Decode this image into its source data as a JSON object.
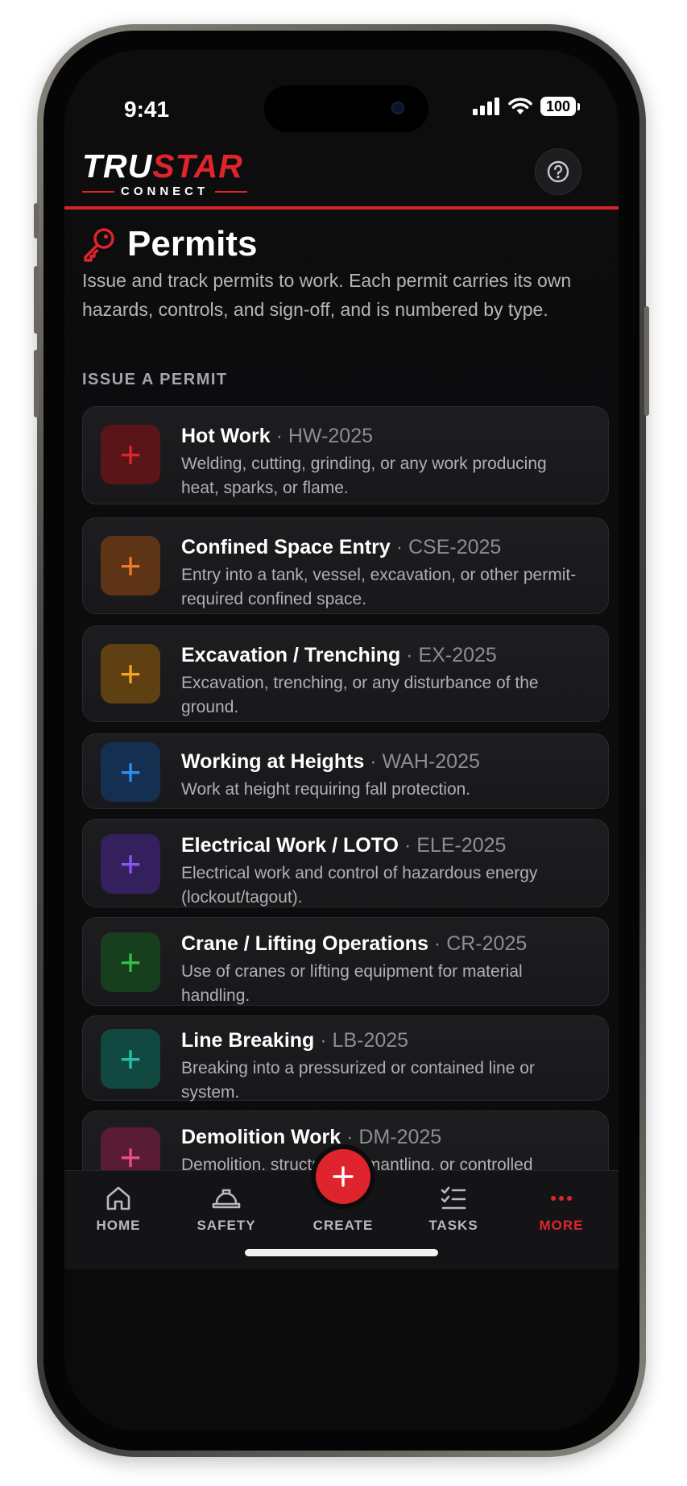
{
  "status_bar": {
    "time": "9:41",
    "battery": "100"
  },
  "header": {
    "logo_tru": "TRU",
    "logo_star": "STAR",
    "logo_sub": "CONNECT",
    "help_icon": "question-circle-icon"
  },
  "page": {
    "title": "Permits",
    "title_icon": "key-icon",
    "intro": "Issue and track permits to work. Each permit carries its own hazards, controls, and sign-off, and is numbered by type.",
    "section_label": "ISSUE A PERMIT"
  },
  "permits": [
    {
      "title": "Hot Work",
      "code": " · HW-2025",
      "desc": "Welding, cutting, grinding, or any work producing heat, sparks, or flame.",
      "color": "#e0242d",
      "bg": "#5a1518"
    },
    {
      "title": "Confined Space Entry",
      "code": " · CSE-2025",
      "desc": "Entry into a tank, vessel, excavation, or other permit-required confined space.",
      "color": "#f07a2a",
      "bg": "#5e3416"
    },
    {
      "title": "Excavation / Trenching",
      "code": " · EX-2025",
      "desc": "Excavation, trenching, or any disturbance of the ground.",
      "color": "#f5a523",
      "bg": "#5f4012"
    },
    {
      "title": "Working at Heights",
      "code": " · WAH-2025",
      "desc": "Work at height requiring fall protection.",
      "color": "#2f8ff0",
      "bg": "#142f4f"
    },
    {
      "title": "Electrical Work / LOTO",
      "code": " · ELE-2025",
      "desc": "Electrical work and control of hazardous energy (lockout/tagout).",
      "color": "#8a55f2",
      "bg": "#33205c"
    },
    {
      "title": "Crane / Lifting Operations",
      "code": " · CR-2025",
      "desc": "Use of cranes or lifting equipment for material handling.",
      "color": "#34c046",
      "bg": "#183f1d"
    },
    {
      "title": "Line Breaking",
      "code": " · LB-2025",
      "desc": "Breaking into a pressurized or contained line or system.",
      "color": "#23c2a8",
      "bg": "#114840"
    },
    {
      "title": "Demolition Work",
      "code": " · DM-2025",
      "desc": "Demolition, structural dismantling, or controlled deconstruction.",
      "color": "#ea4f86",
      "bg": "#5a1c34"
    }
  ],
  "tabs": {
    "home": "HOME",
    "safety": "SAFETY",
    "create": "CREATE",
    "tasks": "TASKS",
    "more": "MORE"
  },
  "colors": {
    "accent": "#e0242d",
    "background": "#0c0c0d",
    "card": "#1b1b1e"
  }
}
